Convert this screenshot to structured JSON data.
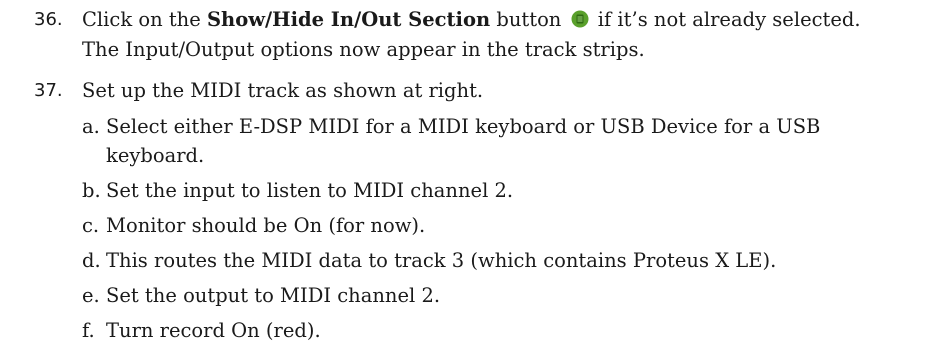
{
  "steps": [
    {
      "number": "36.",
      "line1_pre": "Click on the ",
      "line1_bold": "Show/Hide In/Out Section",
      "line1_mid": " button ",
      "icon": "green-list-icon",
      "line1_post": " if it’s not already selected.",
      "line2": "The Input/Output options now appear in the track strips."
    },
    {
      "number": "37.",
      "line1": "Set up the MIDI track as shown at right."
    }
  ],
  "substeps": [
    {
      "letter": "a.",
      "line1": "Select either E-DSP MIDI for a MIDI keyboard or USB Device for a USB",
      "line2": "keyboard."
    },
    {
      "letter": "b.",
      "line1": "Set the input to listen to MIDI channel 2."
    },
    {
      "letter": "c.",
      "line1": "Monitor should be On (for now)."
    },
    {
      "letter": "d.",
      "line1": "This routes the MIDI data to track 3 (which contains Proteus X LE)."
    },
    {
      "letter": "e.",
      "line1": "Set the output to MIDI channel 2."
    },
    {
      "letter": "f.",
      "line1": "Turn record On (red)."
    }
  ],
  "colors": {
    "icon_green": "#5aa02c",
    "icon_dark": "#2f6b12"
  }
}
